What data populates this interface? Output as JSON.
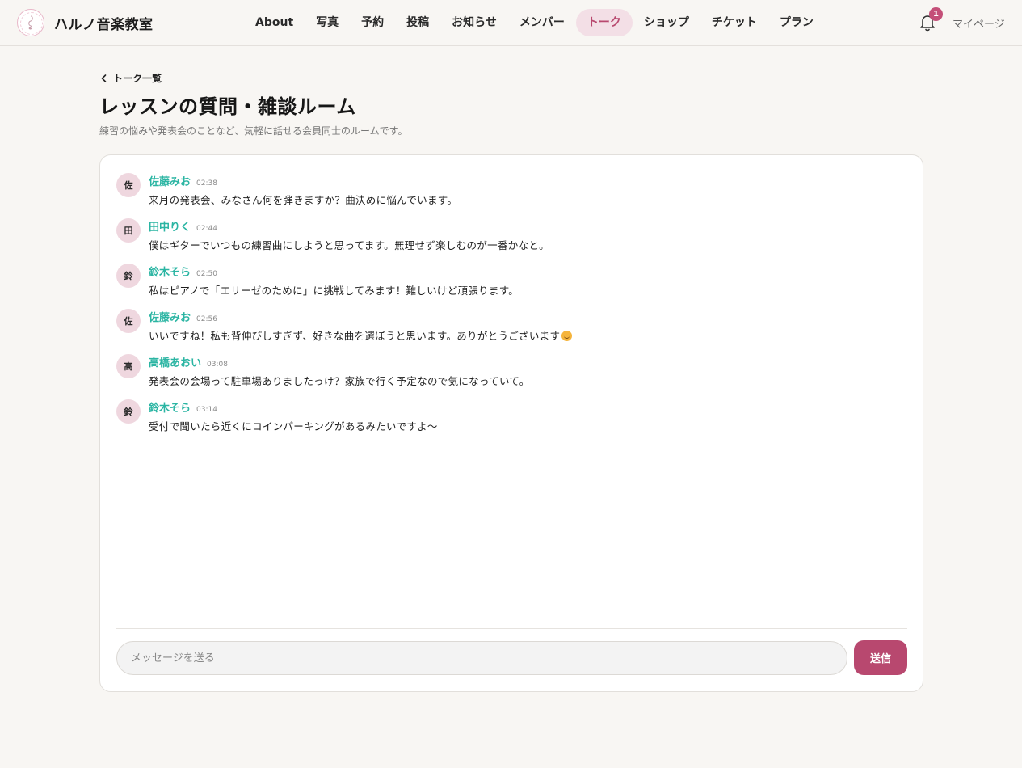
{
  "brand": {
    "name": "ハルノ音楽教室"
  },
  "nav": {
    "items": [
      {
        "label": "About"
      },
      {
        "label": "写真"
      },
      {
        "label": "予約"
      },
      {
        "label": "投稿"
      },
      {
        "label": "お知らせ"
      },
      {
        "label": "メンバー"
      },
      {
        "label": "トーク",
        "active": true
      },
      {
        "label": "ショップ"
      },
      {
        "label": "チケット"
      },
      {
        "label": "プラン"
      }
    ]
  },
  "header": {
    "notification_count": "1",
    "mypage_label": "マイページ"
  },
  "page": {
    "back_label": "トーク一覧",
    "title": "レッスンの質問・雑談ルーム",
    "description": "練習の悩みや発表会のことなど、気軽に話せる会員同士のルームです。"
  },
  "messages": [
    {
      "avatar": "佐",
      "name": "佐藤みお",
      "time": "02:38",
      "text": "来月の発表会、みなさん何を弾きますか？曲決めに悩んでいます。"
    },
    {
      "avatar": "田",
      "name": "田中りく",
      "time": "02:44",
      "text": "僕はギターでいつもの練習曲にしようと思ってます。無理せず楽しむのが一番かなと。"
    },
    {
      "avatar": "鈴",
      "name": "鈴木そら",
      "time": "02:50",
      "text": "私はピアノで「エリーゼのために」に挑戦してみます！難しいけど頑張ります。"
    },
    {
      "avatar": "佐",
      "name": "佐藤みお",
      "time": "02:56",
      "text": "いいですね！私も背伸びしすぎず、好きな曲を選ぼうと思います。ありがとうございます",
      "emoji": "smiling-face-emoji"
    },
    {
      "avatar": "高",
      "name": "高橋あおい",
      "time": "03:08",
      "text": "発表会の会場って駐車場ありましたっけ？家族で行く予定なので気になっていて。"
    },
    {
      "avatar": "鈴",
      "name": "鈴木そら",
      "time": "03:14",
      "text": "受付で聞いたら近くにコインパーキングがあるみたいですよ〜"
    }
  ],
  "composer": {
    "placeholder": "メッセージを送る",
    "send_label": "送信"
  },
  "colors": {
    "accent": "#b8486f",
    "name_teal": "#2bb5a3",
    "avatar_bg": "#efd7df",
    "background": "#f8f6f3"
  }
}
